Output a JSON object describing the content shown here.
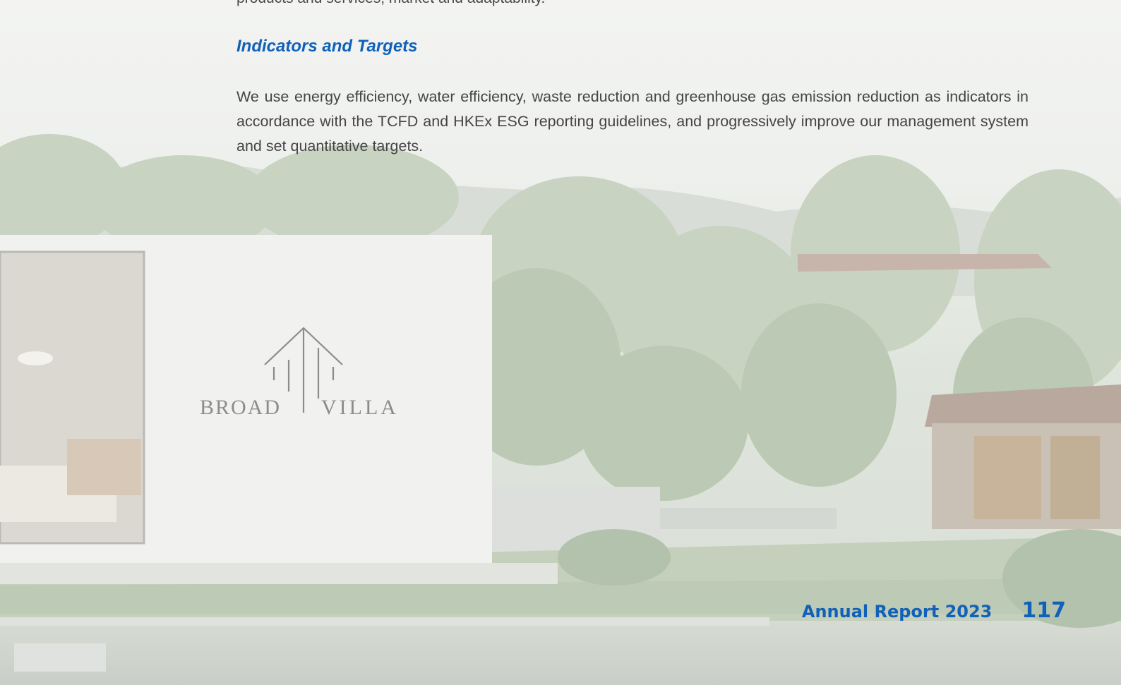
{
  "document": {
    "cut_text": "products and services, market and adaptability.",
    "section_heading": "Indicators and Targets",
    "paragraph": "We use energy efficiency, water efficiency, waste reduction and greenhouse gas emission reduction as indicators in accordance with the TCFD and HKEx ESG reporting guidelines, and progressively improve our management system and set quantitative targets."
  },
  "logo": {
    "left_word": "BROAD",
    "right_word": "VILLA"
  },
  "footer": {
    "report_title": "Annual Report 2023",
    "page_number": "117"
  },
  "colors": {
    "accent": "#1161b8",
    "body_text": "#454545"
  }
}
